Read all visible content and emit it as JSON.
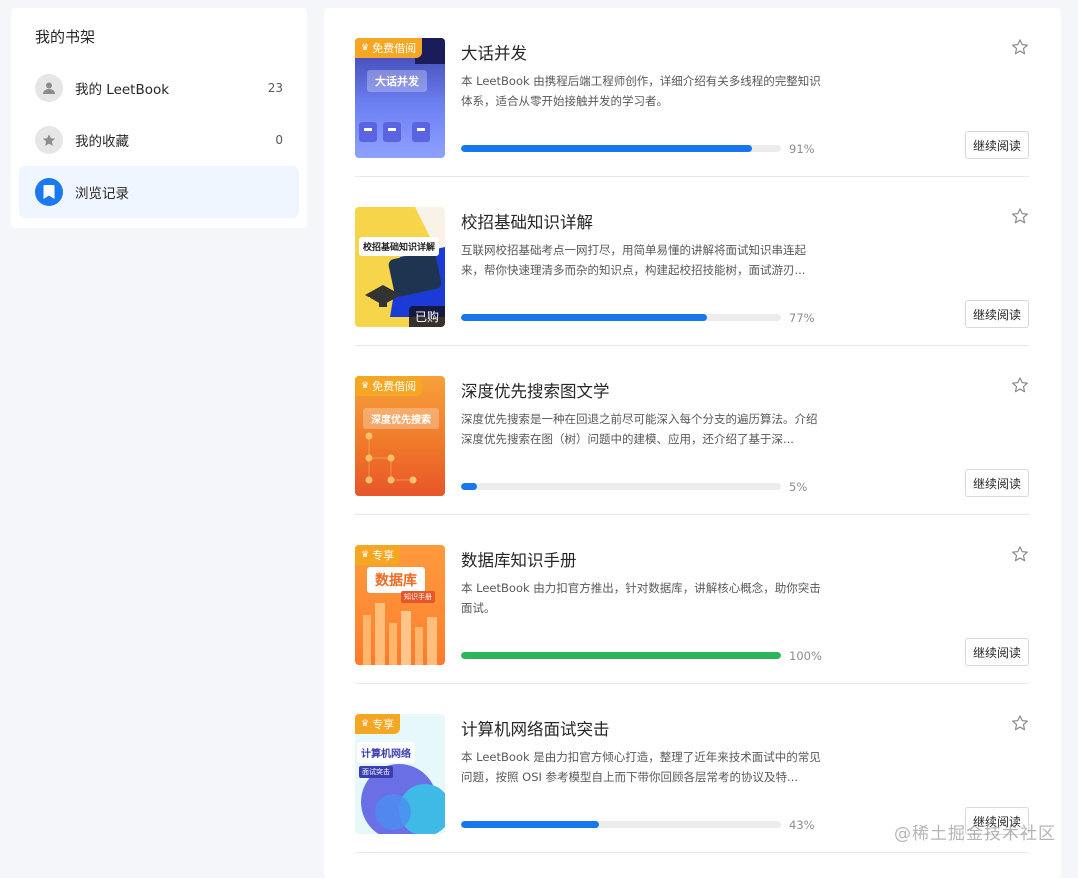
{
  "sidebar": {
    "title": "我的书架",
    "items": [
      {
        "label": "我的 LeetBook",
        "count": "23",
        "icon": "user-icon"
      },
      {
        "label": "我的收藏",
        "count": "0",
        "icon": "star-icon"
      },
      {
        "label": "浏览记录",
        "count": "",
        "icon": "bookmark-icon"
      }
    ]
  },
  "books": [
    {
      "title": "大话并发",
      "desc": "本 LeetBook 由携程后端工程师创作，详细介绍有关多线程的完整知识体系，适合从零开始接触并发的学习者。",
      "progress": 91,
      "progress_label": "91%",
      "tag": "免费借阅",
      "cover_title": "大话并发",
      "badge": "",
      "button": "继续阅读"
    },
    {
      "title": "校招基础知识详解",
      "desc": "互联网校招基础考点一网打尽，用简单易懂的讲解将面试知识串连起来，帮你快速理清多而杂的知识点，构建起校招技能树，面试游刃...",
      "progress": 77,
      "progress_label": "77%",
      "tag": "",
      "cover_title": "校招基础知识详解",
      "badge": "已购",
      "button": "继续阅读"
    },
    {
      "title": "深度优先搜索图文学",
      "desc": "深度优先搜索是一种在回退之前尽可能深入每个分支的遍历算法。介绍深度优先搜索在图（树）问题中的建模、应用，还介绍了基于深...",
      "progress": 5,
      "progress_label": "5%",
      "tag": "免费借阅",
      "cover_title": "深度优先搜索",
      "badge": "",
      "button": "继续阅读"
    },
    {
      "title": "数据库知识手册",
      "desc": "本 LeetBook 由力扣官方推出，针对数据库，讲解核心概念，助你突击面试。",
      "progress": 100,
      "progress_label": "100%",
      "tag": "专享",
      "cover_title": "数据库",
      "cover_sub": "知识手册",
      "badge": "",
      "button": "继续阅读"
    },
    {
      "title": "计算机网络面试突击",
      "desc": "本 LeetBook 是由力扣官方倾心打造，整理了近年来技术面试中的常见问题，按照 OSI 参考模型自上而下带你回顾各层常考的协议及特...",
      "progress": 43,
      "progress_label": "43%",
      "tag": "专享",
      "cover_title": "计算机网络",
      "cover_sub": "面试突击",
      "badge": "",
      "button": "继续阅读"
    }
  ],
  "watermark": "@稀土掘金技术社区",
  "colors": {
    "accent": "#1677ee",
    "complete": "#2db55d",
    "tag": "#f5a623"
  }
}
